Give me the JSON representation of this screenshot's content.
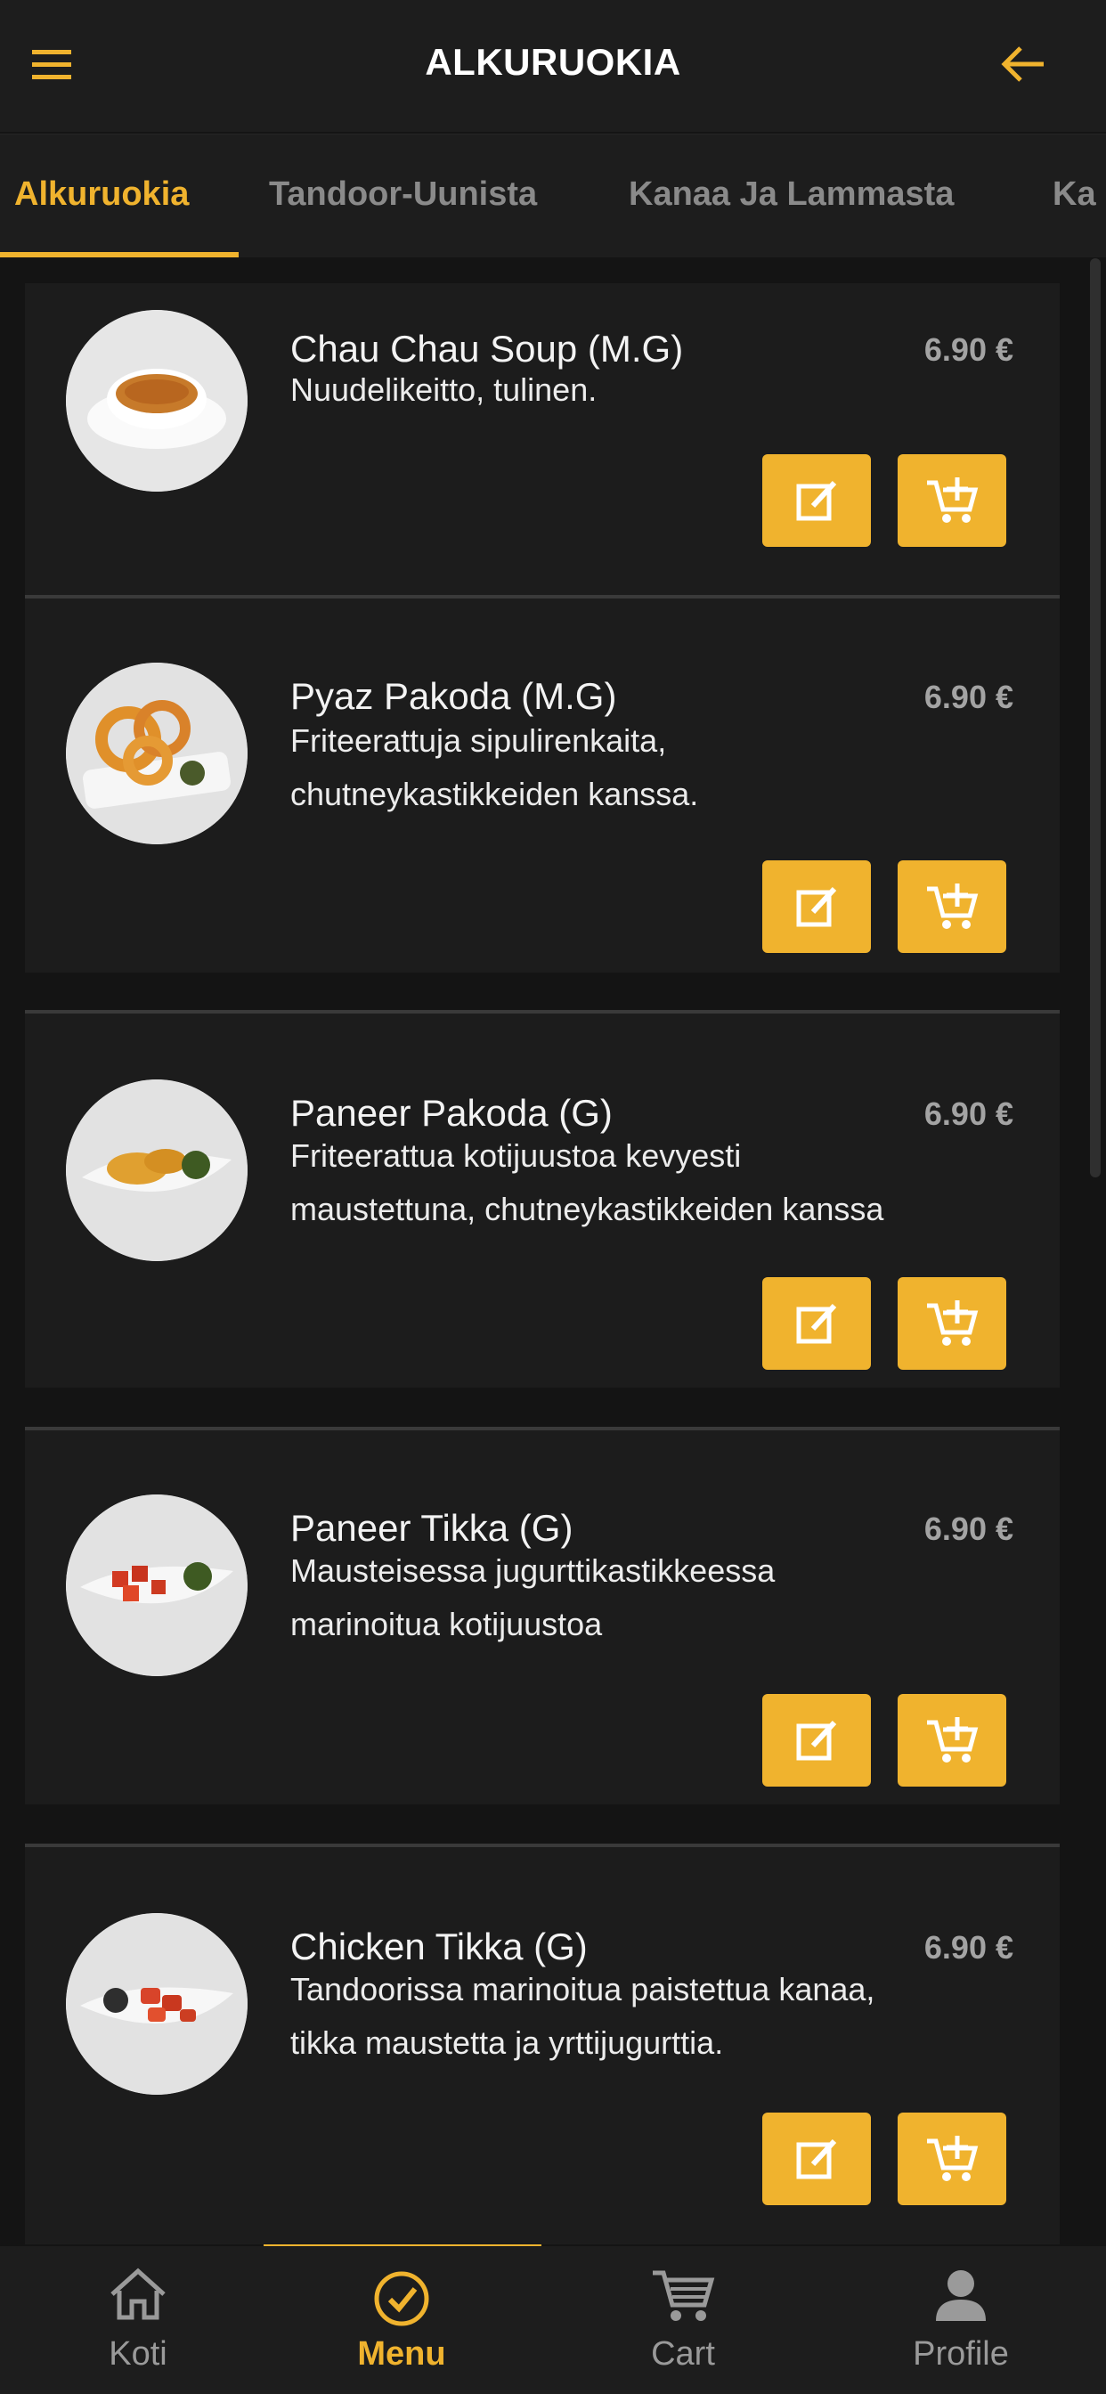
{
  "header": {
    "title": "ALKURUOKIA",
    "menu_icon": "hamburger-icon",
    "back_icon": "arrow-left-icon"
  },
  "tabs": [
    {
      "label": "Alkuruokia",
      "active": true
    },
    {
      "label": "Tandoor-Uunista",
      "active": false
    },
    {
      "label": "Kanaa Ja Lammasta",
      "active": false
    },
    {
      "label": "Ka",
      "active": false
    }
  ],
  "items": [
    {
      "name": "Chau Chau Soup (M.G)",
      "price": "6.90 €",
      "desc_lines": [
        "Nuudelikeitto, tulinen."
      ]
    },
    {
      "name": "Pyaz Pakoda (M.G)",
      "price": "6.90 €",
      "desc_lines": [
        "Friteerattuja sipulirenkaita,",
        "chutneykastikkeiden kanssa."
      ]
    },
    {
      "name": "Paneer Pakoda (G)",
      "price": "6.90 €",
      "desc_lines": [
        "Friteerattua kotijuustoa kevyesti",
        "maustettuna, chutneykastikkeiden kanssa"
      ]
    },
    {
      "name": "Paneer Tikka (G)",
      "price": "6.90 €",
      "desc_lines": [
        "Mausteisessa jugurttikastikkeessa",
        "marinoitua kotijuustoa"
      ]
    },
    {
      "name": "Chicken Tikka (G)",
      "price": "6.90 €",
      "desc_lines": [
        "Tandoorissa marinoitua paistettua kanaa,",
        "tikka maustetta ja yrttijugurttia."
      ]
    }
  ],
  "buttons": {
    "edit_icon": "edit-icon",
    "cart_icon": "add-to-cart-icon"
  },
  "bottom_nav": [
    {
      "label": "Koti",
      "icon": "home-icon",
      "active": false
    },
    {
      "label": "Menu",
      "icon": "check-circle-icon",
      "active": true
    },
    {
      "label": "Cart",
      "icon": "cart-icon",
      "active": false
    },
    {
      "label": "Profile",
      "icon": "person-icon",
      "active": false
    }
  ],
  "colors": {
    "accent": "#f0b32e",
    "background": "#141414",
    "card": "#1c1c1c"
  }
}
